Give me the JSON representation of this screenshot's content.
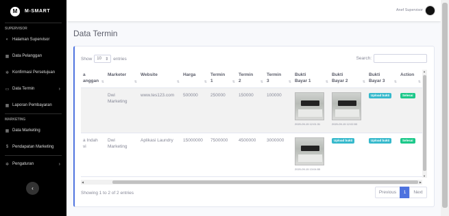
{
  "brand": {
    "logo": "M",
    "name": "M-SMART"
  },
  "sidebar": {
    "sections": [
      {
        "heading": "SUPERVISOR"
      },
      {
        "heading": "MARKETING"
      }
    ],
    "items": [
      {
        "label": "Halaman Supervisor",
        "icon": "dashboard-icon"
      },
      {
        "label": "Data Pelanggan",
        "icon": "table-icon"
      },
      {
        "label": "Konfirmasi Persetujuan",
        "icon": "gear-icon"
      },
      {
        "label": "Data Termin",
        "icon": "folder-icon"
      },
      {
        "label": "Laporan Pembayaran",
        "icon": "table-icon"
      },
      {
        "label": "Data Marketing",
        "icon": "table-icon"
      },
      {
        "label": "Pendapatan Marketing",
        "icon": "dollar-icon"
      },
      {
        "label": "Pengaturan",
        "icon": "gear-icon"
      }
    ]
  },
  "topbar": {
    "user_name": "Anef Supervisor"
  },
  "page": {
    "title": "Data Termin"
  },
  "table_controls": {
    "show_label": "Show",
    "entries_value": "10",
    "entries_label": "entries",
    "search_label": "Search:"
  },
  "columns": [
    "a\nanggan",
    "Marketer",
    "Website",
    "Harga",
    "Termin\n1",
    "Termin\n2",
    "Termin\n3",
    "Bukti\nBayar 1",
    "Bukti\nBayar 2",
    "Bukti\nBayar 3",
    "Action"
  ],
  "rows": [
    {
      "pelanggan": "",
      "marketer": "Dwi\nMarketing",
      "website": "www.tes123.com",
      "harga": "500000",
      "termin1": "250000",
      "termin2": "150000",
      "termin3": "100000",
      "bukti1_date": "2020-09-15 12:01:31",
      "bukti2_date": "2020-09-15 12:02:53",
      "bukti3_label": "Upload bukti",
      "action": "Selesai"
    },
    {
      "pelanggan": "a Indah\nvi",
      "marketer": "Dwi\nMarketing",
      "website": "Aplikasi Laundry",
      "harga": "15000000",
      "termin1": "7500000",
      "termin2": "4500000",
      "termin3": "3000000",
      "bukti1_date": "2020-09-15 13:04:55",
      "bukti2_label": "Upload bukti",
      "bukti3_label": "Upload bukti",
      "action": "Selesai"
    }
  ],
  "footer": {
    "info": "Showing 1 to 2 of 2 entries",
    "prev": "Previous",
    "page": "1",
    "next": "Next"
  },
  "colors": {
    "sidebar": "#000000",
    "accent": "#4e73df",
    "info": "#36b9cc",
    "success": "#1cc88a"
  }
}
